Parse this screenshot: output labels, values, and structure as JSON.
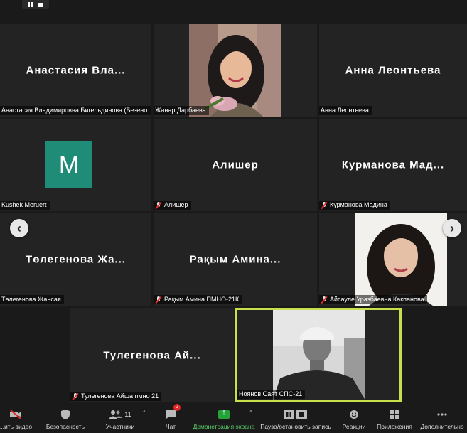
{
  "recording_controls": {
    "pause_icon": "pause-icon",
    "stop_icon": "stop-icon"
  },
  "tiles": [
    {
      "center_name": "Анастасия Вла...",
      "label": "Анастасия Владимировна Бигельдинова (Безено...",
      "muted": false
    },
    {
      "center_name": "",
      "label": "Жанар Дарбаева",
      "muted": false
    },
    {
      "center_name": "Анна Леонтьева",
      "label": "Анна Леонтьева",
      "muted": false
    },
    {
      "center_name": "",
      "label": "Kushek Meruert",
      "muted": false,
      "avatar_letter": "M"
    },
    {
      "center_name": "Алишер",
      "label": "Алишер",
      "muted": true
    },
    {
      "center_name": "Курманова Мад...",
      "label": "Курманова Мадина",
      "muted": true
    },
    {
      "center_name": "Төлегенова Жа...",
      "label": "Төлегенова Жансая",
      "muted": false
    },
    {
      "center_name": "Рақым Амина...",
      "label": "Рақым Амина ПМНО-21К",
      "muted": true
    },
    {
      "center_name": "",
      "label": "Айсауле Уразбаевна Какпанова",
      "muted": true
    },
    {
      "center_name": "Тулегенова Ай...",
      "label": "Тулегенова Айша пмно 21",
      "muted": true
    },
    {
      "center_name": "",
      "label": "Ноянов Саят СПС-21",
      "muted": false
    }
  ],
  "navigation": {
    "prev": "‹",
    "next": "›"
  },
  "toolbar": {
    "video": "...ить видео",
    "security": "Безопасность",
    "participants": "Участники",
    "participants_count": "11",
    "chat": "Чат",
    "chat_badge": "2",
    "share": "Демонстрация экрана",
    "record": "Пауза/остановить запись",
    "reactions": "Реакции",
    "apps": "Приложения",
    "more": "Дополнительно"
  },
  "colors": {
    "share_accent": "#23a33a",
    "active_speaker": "#c8e04a",
    "avatar_bg": "#1f8c78"
  }
}
